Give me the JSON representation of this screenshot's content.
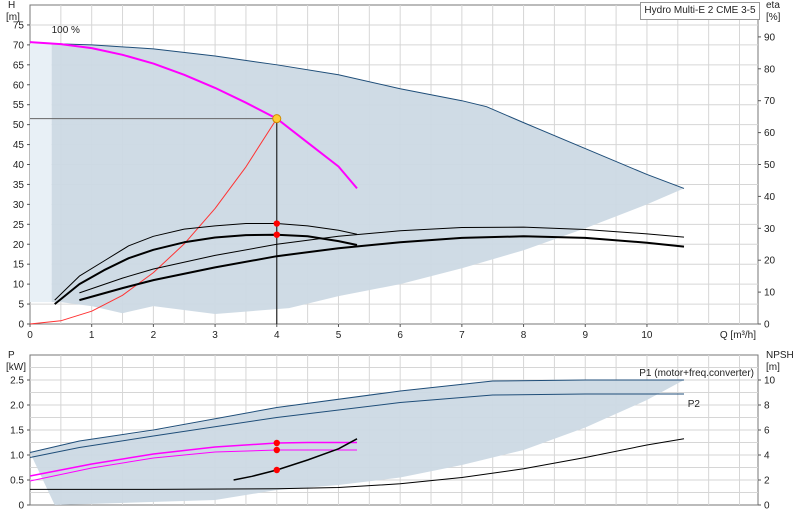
{
  "title": "Hydro Multi-E 2 CME 3-5",
  "colors": {
    "grid": "#d6d6d6",
    "region": "#ccd9e4",
    "region_edge": "#1f4e79",
    "magenta": "#ff00ff",
    "black": "#000000",
    "red_thin": "#ff3333",
    "duty_point": "#ff0000",
    "opt_marker": "#ffcc33"
  },
  "chart_data": [
    {
      "type": "line",
      "id": "qh",
      "xlabel": "Q [m³/h]",
      "ylabel_left": "H",
      "ylabel_left_unit": "[m]",
      "ylabel_right": "eta",
      "ylabel_right_unit": "[%]",
      "xlim": [
        0,
        11.8
      ],
      "ylim": [
        0,
        80
      ],
      "y2lim": [
        0,
        100
      ],
      "xticks": [
        0,
        1,
        2,
        3,
        4,
        5,
        6,
        7,
        8,
        9,
        10
      ],
      "yticks": [
        0,
        5,
        10,
        15,
        20,
        25,
        30,
        35,
        40,
        45,
        50,
        55,
        60,
        65,
        70,
        75
      ],
      "y2ticks": [
        0,
        10,
        20,
        30,
        40,
        50,
        60,
        70,
        80,
        90
      ],
      "annotation": "100 %",
      "duty_point": {
        "q": 4,
        "h": 51.5
      },
      "region_max": [
        [
          0.35,
          70.3
        ],
        [
          1,
          70
        ],
        [
          2,
          69
        ],
        [
          3,
          67.2
        ],
        [
          4,
          65
        ],
        [
          5,
          62.5
        ],
        [
          6,
          59
        ],
        [
          7,
          56
        ],
        [
          7.4,
          54.5
        ],
        [
          8,
          50.5
        ],
        [
          9,
          44
        ],
        [
          10,
          37.5
        ],
        [
          10.6,
          34
        ]
      ],
      "region_min": [
        [
          10.6,
          34
        ],
        [
          10,
          30
        ],
        [
          9,
          24
        ],
        [
          8,
          18.5
        ],
        [
          7,
          14
        ],
        [
          6,
          10
        ],
        [
          5,
          7
        ],
        [
          4.2,
          4
        ],
        [
          3,
          2.5
        ],
        [
          2,
          4.5
        ],
        [
          1.5,
          2.7
        ],
        [
          1,
          4.5
        ],
        [
          0.5,
          5.5
        ],
        [
          0.35,
          5.5
        ]
      ],
      "series": [
        {
          "role": "head-100",
          "color": "magenta",
          "width": 2,
          "points": [
            [
              0,
              70.7
            ],
            [
              0.5,
              70.2
            ],
            [
              1,
              69.2
            ],
            [
              1.5,
              67.5
            ],
            [
              2,
              65.3
            ],
            [
              2.5,
              62.5
            ],
            [
              3,
              59.2
            ],
            [
              3.5,
              55.5
            ],
            [
              4,
              51.5
            ],
            [
              4.5,
              45.5
            ],
            [
              5,
              39.5
            ],
            [
              5.3,
              34
            ]
          ]
        },
        {
          "role": "system-curve",
          "color": "red_thin",
          "width": 1,
          "points": [
            [
              0,
              0
            ],
            [
              0.5,
              0.8
            ],
            [
              1,
              3.2
            ],
            [
              1.5,
              7.2
            ],
            [
              2,
              12.9
            ],
            [
              2.5,
              20.1
            ],
            [
              3,
              29
            ],
            [
              3.5,
              39.4
            ],
            [
              4,
              51.5
            ]
          ]
        },
        {
          "role": "eta-max",
          "color": "black",
          "width": 1,
          "points": [
            [
              0.4,
              6
            ],
            [
              0.8,
              12
            ],
            [
              1.2,
              15.8
            ],
            [
              1.6,
              19.6
            ],
            [
              2,
              22
            ],
            [
              2.5,
              23.8
            ],
            [
              3,
              24.6
            ],
            [
              3.5,
              25.2
            ],
            [
              4,
              25.2
            ],
            [
              4.5,
              24.6
            ],
            [
              5,
              23.5
            ],
            [
              5.3,
              22.5
            ]
          ]
        },
        {
          "role": "eta-100",
          "color": "black",
          "width": 2,
          "points": [
            [
              0.4,
              5
            ],
            [
              0.8,
              10
            ],
            [
              1.2,
              13.5
            ],
            [
              1.6,
              16.5
            ],
            [
              2,
              18.6
            ],
            [
              2.5,
              20.5
            ],
            [
              3,
              21.7
            ],
            [
              3.5,
              22.3
            ],
            [
              4,
              22.4
            ],
            [
              4.5,
              22
            ],
            [
              5,
              20.8
            ],
            [
              5.3,
              19.8
            ]
          ]
        },
        {
          "role": "eta-max-wide",
          "color": "black",
          "width": 1,
          "points": [
            [
              0.8,
              7.8
            ],
            [
              1.5,
              11.5
            ],
            [
              2,
              13.8
            ],
            [
              3,
              17.2
            ],
            [
              4,
              20
            ],
            [
              5,
              22
            ],
            [
              6,
              23.4
            ],
            [
              7,
              24.2
            ],
            [
              8,
              24.3
            ],
            [
              9,
              23.7
            ],
            [
              10,
              22.6
            ],
            [
              10.6,
              21.8
            ]
          ]
        },
        {
          "role": "eta-100-wide",
          "color": "black",
          "width": 2,
          "points": [
            [
              0.8,
              6
            ],
            [
              1.5,
              9
            ],
            [
              2,
              11
            ],
            [
              3,
              14.2
            ],
            [
              4,
              17
            ],
            [
              5,
              19
            ],
            [
              6,
              20.5
            ],
            [
              7,
              21.6
            ],
            [
              8,
              22
            ],
            [
              9,
              21.6
            ],
            [
              10,
              20.4
            ],
            [
              10.6,
              19.4
            ]
          ]
        },
        {
          "role": "duty-vertical",
          "color": "black",
          "width": 1,
          "points": [
            [
              4,
              0
            ],
            [
              4,
              51.5
            ]
          ]
        },
        {
          "role": "duty-horizontal",
          "color": "#666666",
          "width": 1,
          "points": [
            [
              0,
              51.5
            ],
            [
              4,
              51.5
            ]
          ]
        }
      ],
      "markers": [
        {
          "q": 4,
          "h": 25.2,
          "color": "duty_point"
        },
        {
          "q": 4,
          "h": 22.4,
          "color": "duty_point"
        },
        {
          "q": 4,
          "h": 51.5,
          "color": "opt_marker"
        }
      ]
    },
    {
      "type": "line",
      "id": "power",
      "xlabel": "",
      "ylabel_left": "P",
      "ylabel_left_unit": "[kW]",
      "ylabel_right": "NPSH",
      "ylabel_right_unit": "[m]",
      "xlim": [
        0,
        11.8
      ],
      "ylim": [
        0,
        3
      ],
      "y2lim": [
        0,
        12
      ],
      "yticks": [
        0,
        0.5,
        1.0,
        1.5,
        2.0,
        2.5
      ],
      "ytick_labels": [
        "0",
        "0.5",
        "1.0",
        "1.5",
        "2.0",
        "2.5"
      ],
      "y2ticks": [
        0,
        2,
        4,
        6,
        8,
        10
      ],
      "legend": [
        {
          "label": "P1 (motor+freq.converter)",
          "color": "#1f4e79"
        },
        {
          "label": "P2",
          "color": "#1f4e79"
        }
      ],
      "region_max": [
        [
          0,
          1.05
        ],
        [
          0.8,
          1.28
        ],
        [
          2,
          1.48
        ],
        [
          4,
          1.95
        ],
        [
          6,
          2.28
        ],
        [
          7.5,
          2.48
        ],
        [
          9,
          2.5
        ],
        [
          10.6,
          2.5
        ]
      ],
      "region_min": [
        [
          10.6,
          2.5
        ],
        [
          10,
          2.1
        ],
        [
          9,
          1.55
        ],
        [
          8,
          1.1
        ],
        [
          7,
          0.8
        ],
        [
          6,
          0.55
        ],
        [
          5,
          0.4
        ],
        [
          4,
          0.3
        ],
        [
          3,
          0.1
        ],
        [
          0.4,
          0
        ]
      ],
      "series": [
        {
          "role": "P1-max",
          "color": "region_edge",
          "width": 1,
          "points": [
            [
              0,
              1.05
            ],
            [
              0.8,
              1.28
            ],
            [
              2,
              1.5
            ],
            [
              4,
              1.95
            ],
            [
              6,
              2.28
            ],
            [
              7.5,
              2.48
            ],
            [
              9,
              2.5
            ],
            [
              10.6,
              2.5
            ]
          ]
        },
        {
          "role": "P2-max",
          "color": "region_edge",
          "width": 1,
          "points": [
            [
              0,
              0.95
            ],
            [
              0.8,
              1.15
            ],
            [
              2,
              1.38
            ],
            [
              4,
              1.75
            ],
            [
              6,
              2.05
            ],
            [
              7.5,
              2.2
            ],
            [
              9,
              2.22
            ],
            [
              10.6,
              2.22
            ]
          ]
        },
        {
          "role": "P1-100",
          "color": "magenta",
          "width": 1.5,
          "points": [
            [
              0,
              0.58
            ],
            [
              1,
              0.82
            ],
            [
              2,
              1.02
            ],
            [
              3,
              1.16
            ],
            [
              4,
              1.24
            ],
            [
              4.5,
              1.25
            ],
            [
              5.3,
              1.25
            ]
          ]
        },
        {
          "role": "P2-100",
          "color": "magenta",
          "width": 1,
          "points": [
            [
              0,
              0.48
            ],
            [
              1,
              0.74
            ],
            [
              2,
              0.94
            ],
            [
              3,
              1.06
            ],
            [
              4,
              1.1
            ],
            [
              4.5,
              1.1
            ],
            [
              5.3,
              1.1
            ]
          ]
        },
        {
          "role": "NPSH-100",
          "color": "black",
          "width": 1.5,
          "points": [
            [
              3.3,
              2
            ],
            [
              3.6,
              2.3
            ],
            [
              4,
              2.8
            ],
            [
              4.5,
              3.6
            ],
            [
              5,
              4.5
            ],
            [
              5.3,
              5.3
            ]
          ]
        },
        {
          "role": "NPSH-max",
          "color": "black",
          "width": 1,
          "points": [
            [
              0,
              1.25
            ],
            [
              2,
              1.25
            ],
            [
              4,
              1.3
            ],
            [
              5,
              1.4
            ],
            [
              6,
              1.7
            ],
            [
              7,
              2.2
            ],
            [
              8,
              2.9
            ],
            [
              9,
              3.8
            ],
            [
              10,
              4.8
            ],
            [
              10.6,
              5.3
            ]
          ]
        }
      ],
      "markers": [
        {
          "q": 4,
          "p": 1.24,
          "color": "duty_point"
        },
        {
          "q": 4,
          "p": 1.1,
          "color": "duty_point"
        },
        {
          "q": 4,
          "npsh": 2.8,
          "color": "duty_point"
        }
      ]
    }
  ]
}
